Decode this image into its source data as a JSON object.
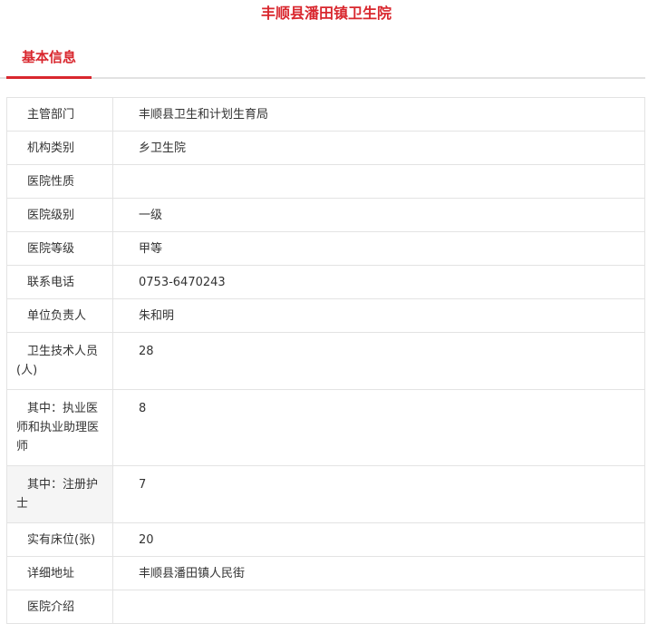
{
  "page": {
    "title": "丰顺县潘田镇卫生院"
  },
  "tabs": [
    {
      "label": "基本信息",
      "active": true
    }
  ],
  "colors": {
    "accent": "#d9272e",
    "border": "#e3e3e3",
    "row_highlight": "#f5f5f5"
  },
  "rows": [
    {
      "label": "主管部门",
      "value": "丰顺县卫生和计划生育局"
    },
    {
      "label": "机构类别",
      "value": "乡卫生院"
    },
    {
      "label": "医院性质",
      "value": ""
    },
    {
      "label": "医院级别",
      "value": "一级"
    },
    {
      "label": "医院等级",
      "value": "甲等"
    },
    {
      "label": "联系电话",
      "value": "0753-6470243"
    },
    {
      "label": "单位负责人",
      "value": "朱和明"
    },
    {
      "label": "卫生技术人员(人)",
      "value": "28"
    },
    {
      "label": "其中：执业医师和执业助理医师",
      "value": "8"
    },
    {
      "label": "其中：注册护士",
      "value": "7"
    },
    {
      "label": "实有床位(张)",
      "value": "20"
    },
    {
      "label": "详细地址",
      "value": "丰顺县潘田镇人民街"
    },
    {
      "label": "医院介绍",
      "value": ""
    }
  ]
}
